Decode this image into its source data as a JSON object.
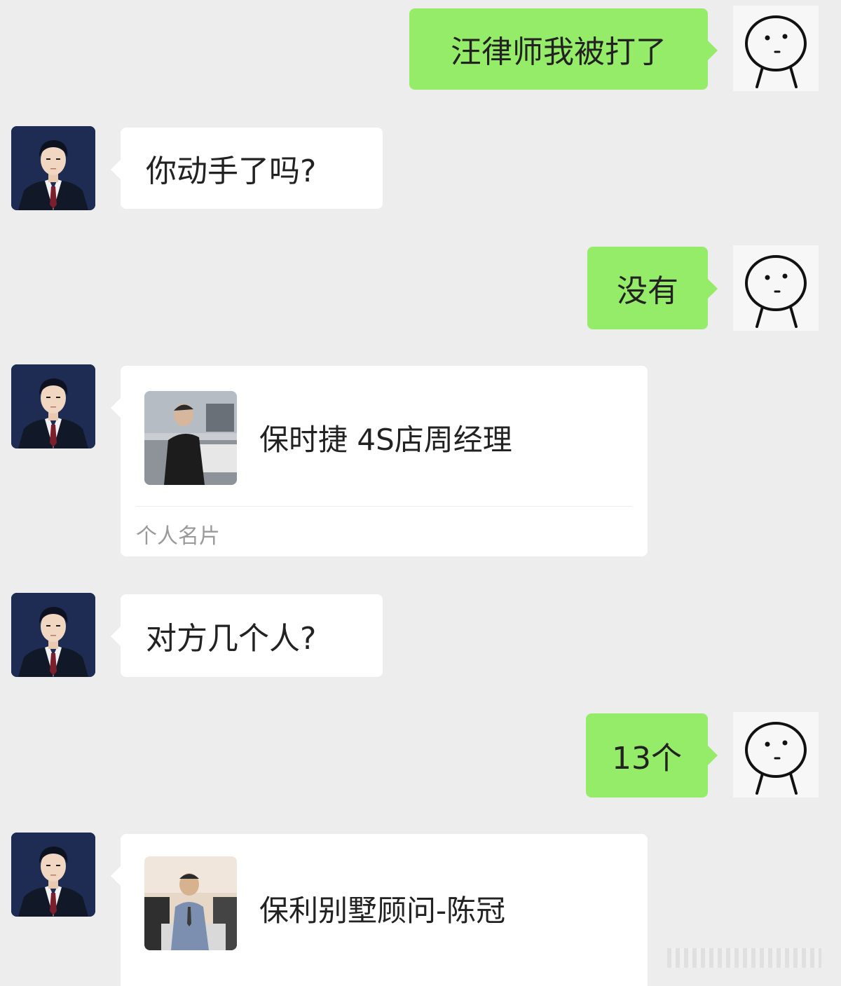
{
  "messages": [
    {
      "side": "right",
      "type": "text",
      "text": "汪律师我被打了"
    },
    {
      "side": "left",
      "type": "text",
      "text": "你动手了吗?"
    },
    {
      "side": "right",
      "type": "text",
      "text": "没有"
    },
    {
      "side": "left",
      "type": "card",
      "name": "保时捷 4S店周经理",
      "card_type": "个人名片"
    },
    {
      "side": "left",
      "type": "text",
      "text": "对方几个人?"
    },
    {
      "side": "right",
      "type": "text",
      "text": "13个"
    },
    {
      "side": "left",
      "type": "card",
      "name": "保利别墅顾问-陈冠"
    }
  ],
  "icons": {
    "lawyer_avatar": "lawyer-avatar-icon",
    "me_avatar": "stick-figure-face-icon"
  },
  "colors": {
    "background": "#ededed",
    "sent_bubble": "#95ec69",
    "received_bubble": "#ffffff",
    "lawyer_avatar_bg": "#1e2b52"
  }
}
